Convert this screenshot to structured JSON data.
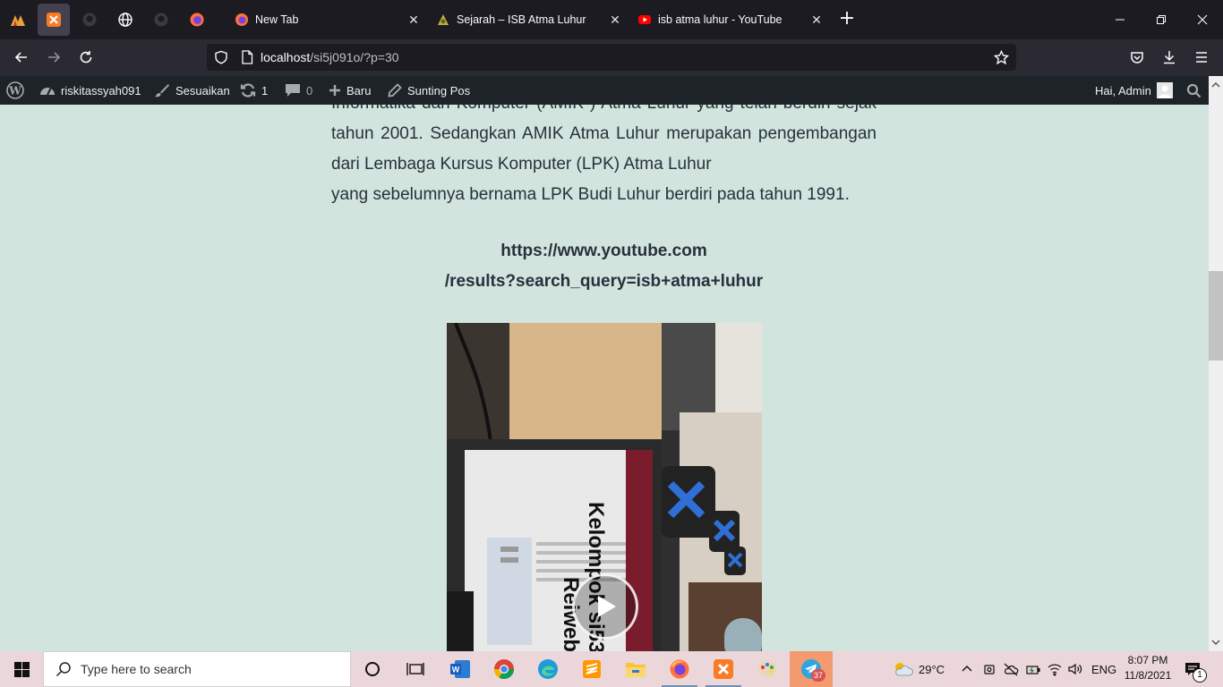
{
  "browser": {
    "tabs": [
      {
        "title": "New Tab"
      },
      {
        "title": "Sejarah – ISB Atma Luhur"
      },
      {
        "title": "isb atma luhur - YouTube"
      }
    ],
    "url_host": "localhost",
    "url_path": "/si5j091o/?p=30"
  },
  "wp_admin_bar": {
    "site_name": "riskitassyah091",
    "customize": "Sesuaikan",
    "updates_count": "1",
    "comments_count": "0",
    "new_label": "Baru",
    "edit_post": "Sunting Pos",
    "greeting": "Hai, Admin"
  },
  "content": {
    "paragraph_top": "Informatika dan Komputer (AMIK ) Atma Luhur yang telah berdiri sejak tahun 2001. Sedangkan AMIK Atma Luhur merupakan pengembangan dari Lembaga Kursus Komputer (LPK) Atma Luhur",
    "paragraph_last": "yang sebelumnya bernama LPK Budi Luhur berdiri pada tahun 1991.",
    "youtube_link_line1": "https://www.youtube.com",
    "youtube_link_line2": "/results?search_query=isb+atma+luhur",
    "video_overlay_line1": "Kelompok si53",
    "video_overlay_line2": "Reiweb"
  },
  "taskbar": {
    "search_placeholder": "Type here to search",
    "weather": "29°C",
    "language": "ENG",
    "time": "8:07 PM",
    "date": "11/8/2021",
    "notification_count": "1",
    "telegram_badge": "37"
  },
  "colors": {
    "page_bg": "#d1e4dd",
    "text": "#28303d",
    "firefox_tabbar": "#1c1b22",
    "firefox_toolbar": "#2b2a33",
    "wp_admin_bar": "#1d2327",
    "taskbar": "#ebd7d9"
  }
}
